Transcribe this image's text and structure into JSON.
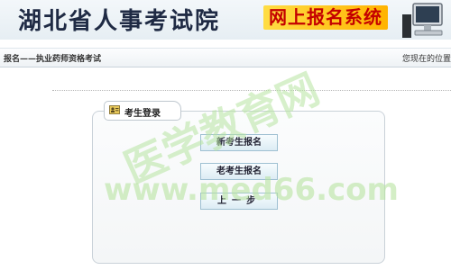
{
  "banner": {
    "site_title": "湖北省人事考试院",
    "system_title": "网上报名系统"
  },
  "nav": {
    "breadcrumb": "报名——执业药师资格考试",
    "location": "您现在的位置"
  },
  "login_panel": {
    "tab_label": "考生登录",
    "buttons": {
      "new_candidate": "新考生报名",
      "returning_candidate": "老考生报名",
      "previous_step": "上一步"
    }
  },
  "watermark": {
    "line1": "医学教育网",
    "line2": "www.med66.com"
  },
  "colors": {
    "title": "#1f2a44",
    "system_title_text": "#c40000",
    "system_title_bg": "#ffcc22",
    "button_border": "#9fc0d2",
    "watermark": "#b7e3a0"
  },
  "icons": [
    "computer-icon",
    "user-card-icon"
  ]
}
